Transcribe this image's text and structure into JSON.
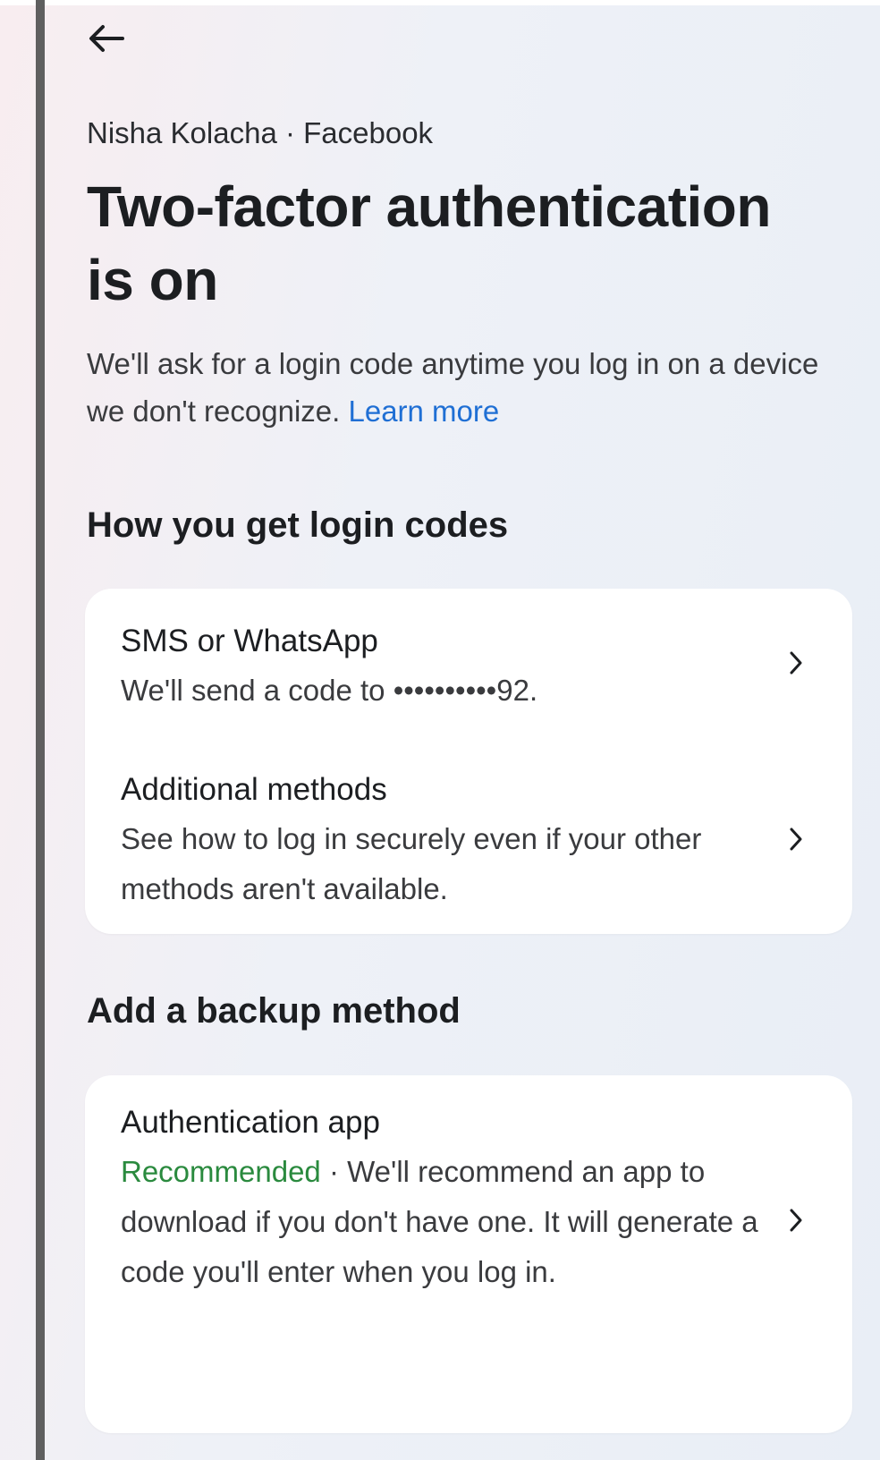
{
  "header": {
    "back_icon": "arrow-left-icon",
    "context": "Nisha Kolacha · Facebook",
    "title": "Two-factor authentication is on"
  },
  "description": {
    "text": "We'll ask for a login code anytime you log in on a device we don't recognize. ",
    "link": "Learn more"
  },
  "login_codes": {
    "heading": "How you get login codes",
    "items": [
      {
        "title": "SMS or WhatsApp",
        "description": "We'll send a code to ••••••••••92.",
        "icon": "chevron-right-icon"
      },
      {
        "title": "Additional methods",
        "description": "See how to log in securely even if your other methods aren't available.",
        "icon": "chevron-right-icon"
      }
    ]
  },
  "backup": {
    "heading": "Add a backup method",
    "items": [
      {
        "title": "Authentication app",
        "recommended_label": "Recommended",
        "separator": " · ",
        "description": "We'll recommend an app to download if you don't have one. It will generate a code you'll enter when you log in.",
        "icon": "chevron-right-icon"
      }
    ]
  },
  "colors": {
    "link": "#1f6fd4",
    "recommended": "#2a8a3e",
    "card_background": "#ffffff",
    "left_rail": "#5f5f5f"
  }
}
